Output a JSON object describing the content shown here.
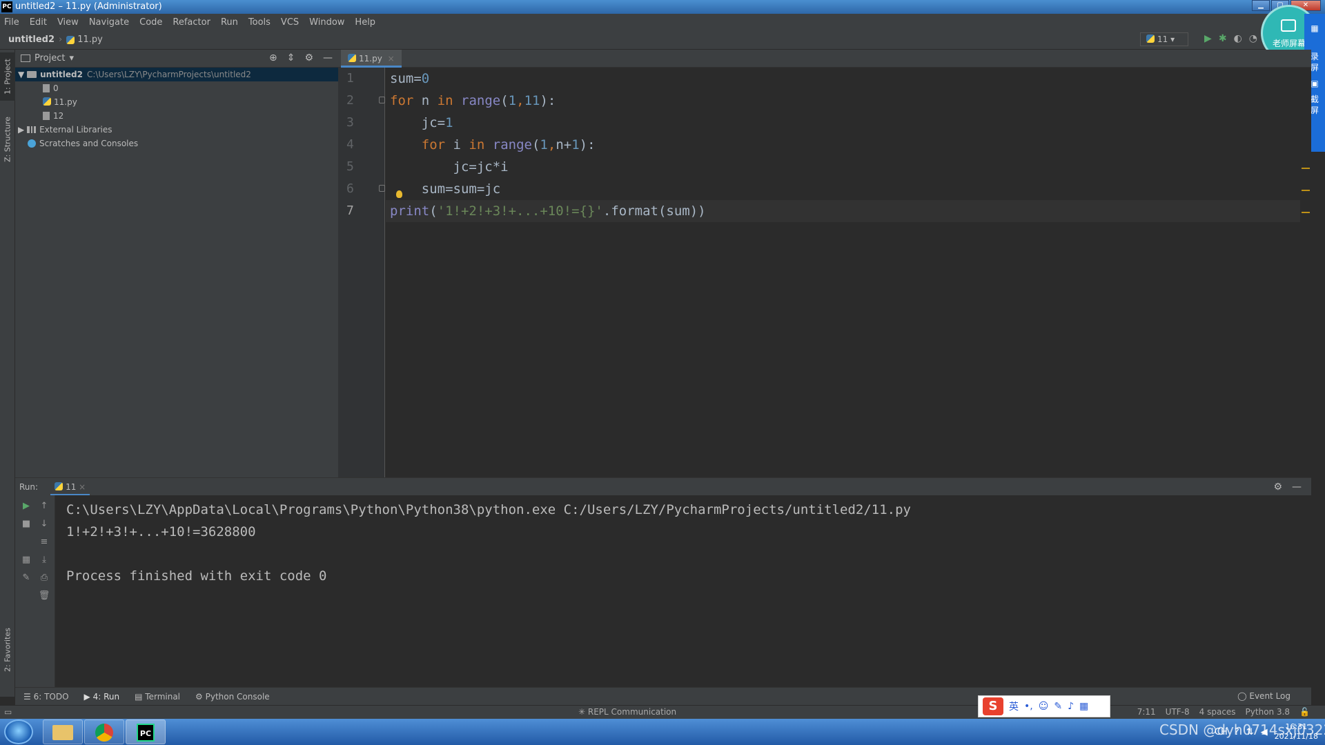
{
  "window": {
    "title": "untitled2 – 11.py (Administrator)",
    "logo": "PC"
  },
  "menu": [
    "File",
    "Edit",
    "View",
    "Navigate",
    "Code",
    "Refactor",
    "Run",
    "Tools",
    "VCS",
    "Window",
    "Help"
  ],
  "breadcrumb": {
    "project": "untitled2",
    "file": "11.py"
  },
  "toolbar": {
    "run_config": "11"
  },
  "teacher_widget": {
    "label": "老师屏幕"
  },
  "side_panel": {
    "record": "录屏",
    "screenshot": "截屏"
  },
  "left_strip": {
    "project_tab": "1: Project",
    "structure_tab": "Z: Structure",
    "favorites_tab": "2: Favorites"
  },
  "project_panel": {
    "title": "Project",
    "root": {
      "name": "untitled2",
      "path": "C:\\Users\\LZY\\PycharmProjects\\untitled2"
    },
    "files": [
      "0",
      "11.py",
      "12"
    ],
    "external_libraries": "External Libraries",
    "scratches": "Scratches and Consoles"
  },
  "editor": {
    "tab": "11.py",
    "line_numbers": [
      "1",
      "2",
      "3",
      "4",
      "5",
      "6",
      "7"
    ],
    "lines": [
      "sum=0",
      "for n in range(1,11):",
      "    jc=1",
      "    for i in range(1,n+1):",
      "        jc=jc*i",
      "    sum=sum=jc",
      "print('1!+2!+3!+...+10!={}'.format(sum))"
    ]
  },
  "run_panel": {
    "label": "Run:",
    "tab": "11",
    "output": [
      "C:\\Users\\LZY\\AppData\\Local\\Programs\\Python\\Python38\\python.exe C:/Users/LZY/PycharmProjects/untitled2/11.py",
      "1!+2!+3!+...+10!=3628800",
      "",
      "Process finished with exit code 0"
    ]
  },
  "bottom_tabs": {
    "todo": "6: TODO",
    "run": "4: Run",
    "terminal": "Terminal",
    "console": "Python Console",
    "event_log": "Event Log"
  },
  "status_bar": {
    "repl": "REPL Communication",
    "position": "7:11",
    "encoding": "UTF-8",
    "indent": "4 spaces",
    "interpreter": "Python 3.8"
  },
  "ime": {
    "logo": "S",
    "mode": "英"
  },
  "taskbar": {
    "tray_lang": "CH",
    "time": "16:31",
    "date": "2021/11/18",
    "watermark": "CSDN @dyh0714sxj0322"
  },
  "colors": {
    "keyword": "#cc7832",
    "number": "#6897bb",
    "string": "#6a8759",
    "builtin": "#8888c6",
    "accent": "#4a88c7"
  }
}
